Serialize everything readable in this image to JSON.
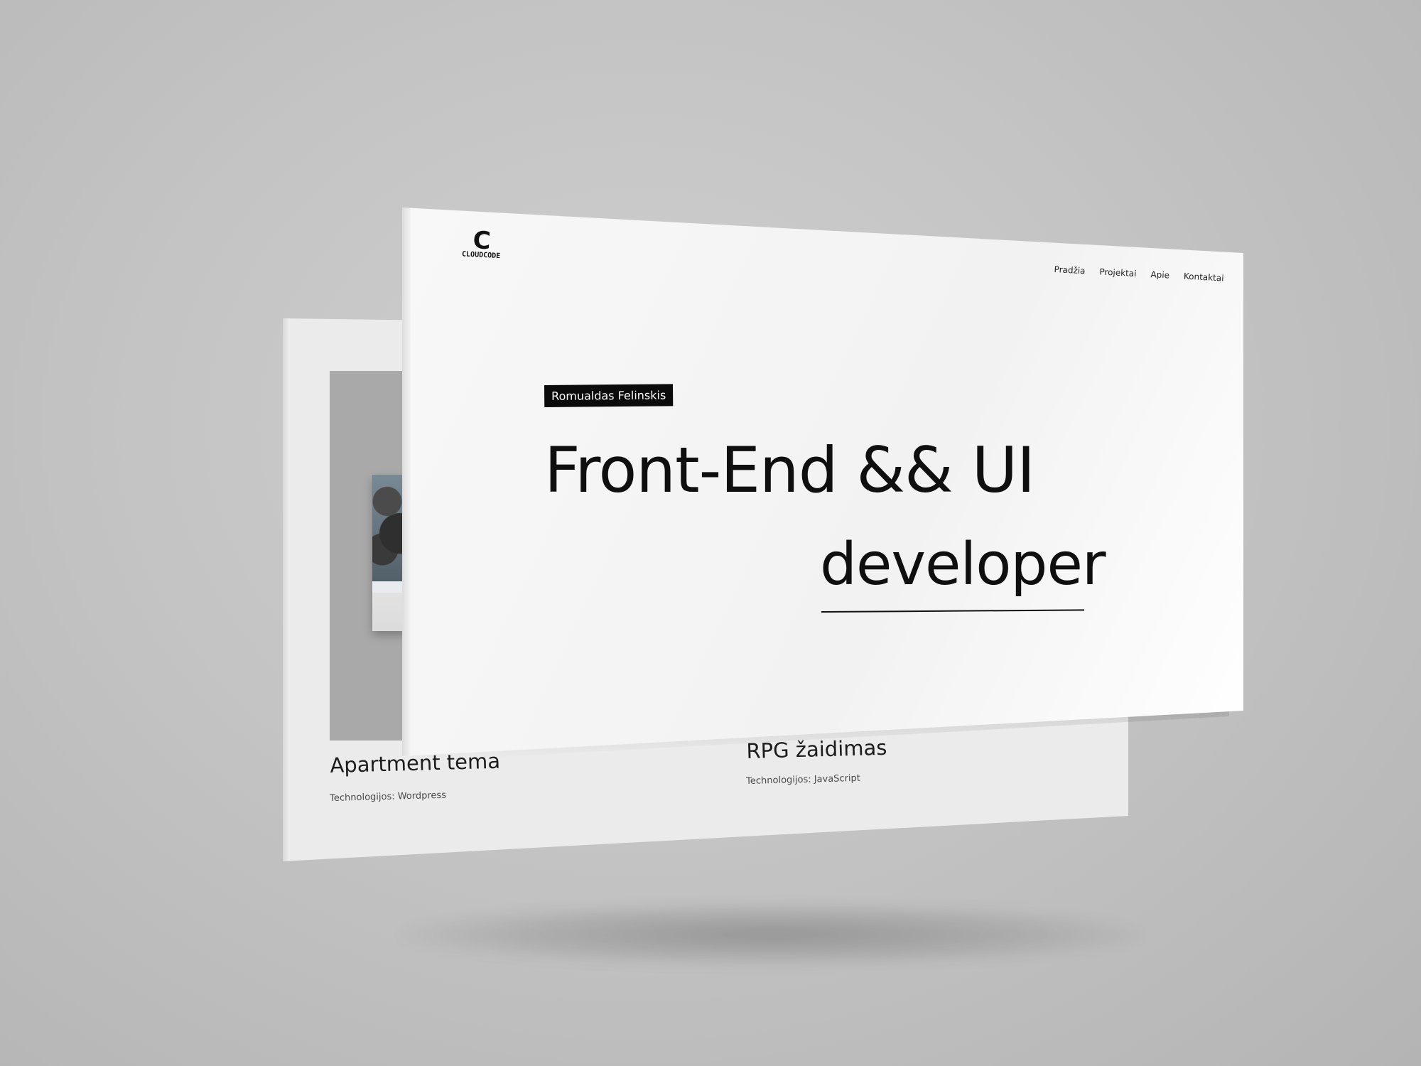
{
  "back_page": {
    "projects": [
      {
        "title": "Apartment tema",
        "tech": "Technologijos: Wordpress"
      },
      {
        "title": "RPG žaidimas",
        "tech": "Technologijos: JavaScript"
      }
    ]
  },
  "front_page": {
    "logo": {
      "mark": "C",
      "text": "CLOUDCODE"
    },
    "nav": [
      {
        "label": "Pradžia"
      },
      {
        "label": "Projektai"
      },
      {
        "label": "Apie"
      },
      {
        "label": "Kontaktai"
      }
    ],
    "hero": {
      "name_tag": "Romualdas Felinskis",
      "line1": "Front-End && UI",
      "line2": "developer"
    }
  }
}
